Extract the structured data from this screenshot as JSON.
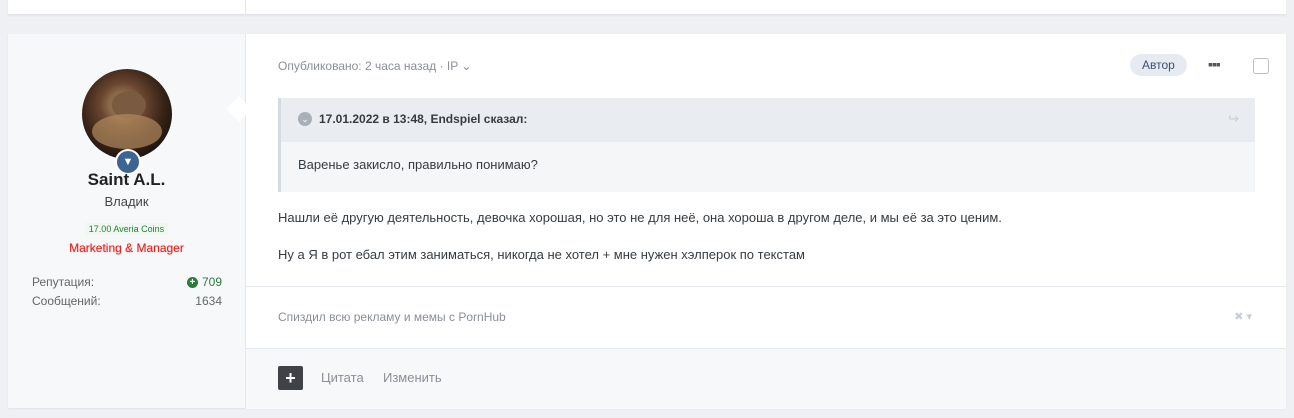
{
  "author": {
    "username": "Saint A.L.",
    "title": "Владик",
    "coins": "17.00 Averia Coins",
    "group": "Marketing & Manager",
    "stats": [
      {
        "label": "Репутация:",
        "value": "709"
      },
      {
        "label": "Сообщений:",
        "value": "1634"
      }
    ]
  },
  "post": {
    "meta": "Опубликовано: 2 часа назад · IP",
    "author_badge": "Автор",
    "quote": {
      "header": "17.01.2022 в 13:48, Endspiel сказал:",
      "text": "Варенье закисло, правильно понимаю?"
    },
    "paragraphs": [
      "Нашли её другую деятельность, девочка хорошая, но это не для неё, она хороша в другом деле, и мы её за это ценим.",
      "Ну а Я в рот ебал этим заниматься, никогда не хотел + мне нужен хэлперок по текстам"
    ],
    "signature": "Спиздил всю рекламу и мемы с PornHub"
  },
  "actions": {
    "quote_label": "Цитата",
    "edit_label": "Изменить"
  },
  "colors": {
    "accent": "#3d6594",
    "group_color": "#e0241c",
    "reputation_positive": "#2a7a3a"
  }
}
